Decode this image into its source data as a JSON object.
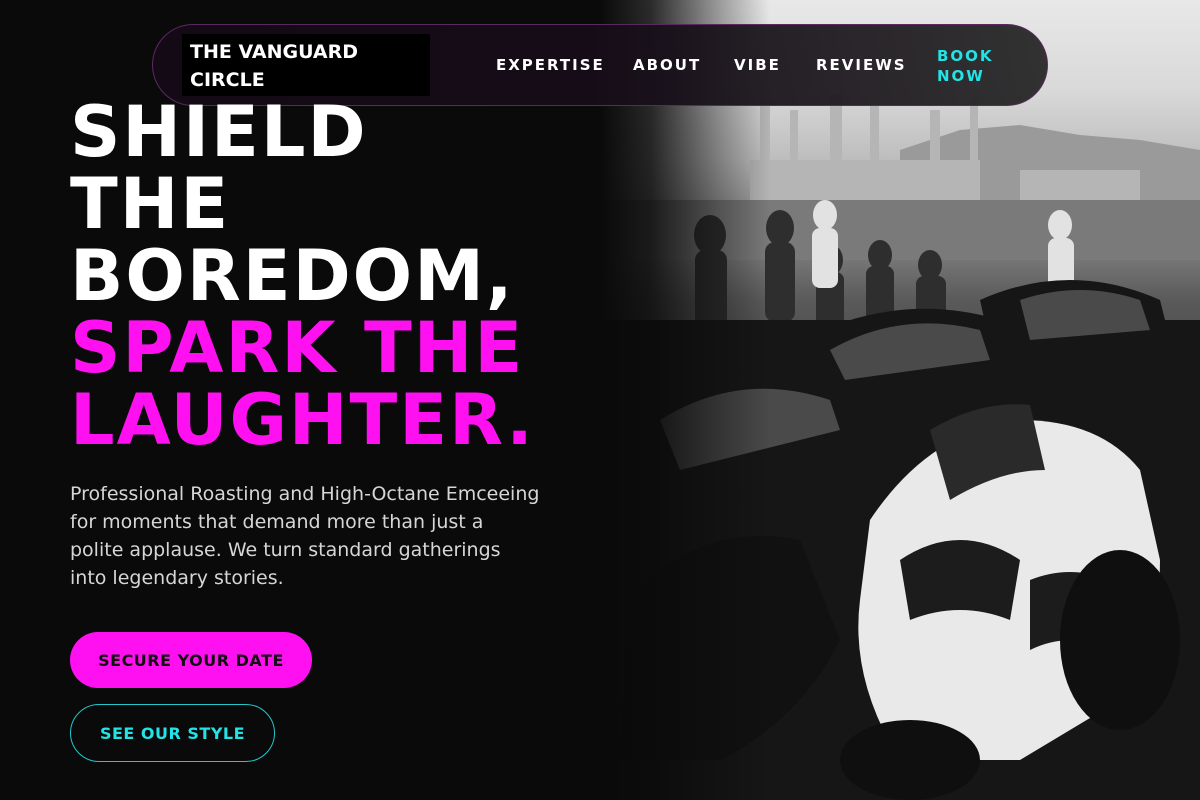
{
  "brand": {
    "name": "THE VANGUARD CIRCLE"
  },
  "nav": {
    "items": [
      {
        "label": "EXPERTISE"
      },
      {
        "label": "ABOUT"
      },
      {
        "label": "VIBE"
      },
      {
        "label": "REVIEWS"
      }
    ],
    "book_label": "BOOK NOW"
  },
  "hero": {
    "headline_line1": "SHIELD",
    "headline_line2": "THE",
    "headline_line3": "BOREDOM,",
    "headline_accent1": "SPARK THE",
    "headline_accent2": "LAUGHTER.",
    "lead": "Professional Roasting and High-Octane Emceeing for moments that demand more than just a polite applause. We turn standard gatherings into legendary stories.",
    "primary_cta": "SECURE YOUR DATE",
    "secondary_cta": "SEE OUR STYLE",
    "image_alt": "Black and white photo of motorcycles parked near a harbor"
  },
  "colors": {
    "accent_pink": "#ff10f0",
    "accent_cyan": "#22e3e6",
    "background": "#0a0a0a"
  }
}
